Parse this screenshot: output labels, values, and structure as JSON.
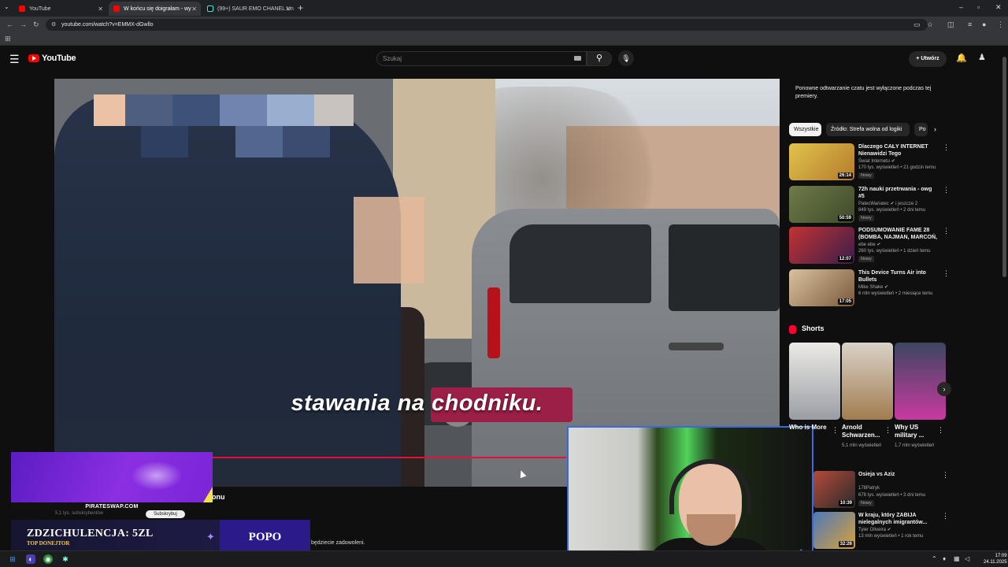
{
  "browser": {
    "tabs": [
      {
        "title": "YouTube",
        "active": false
      },
      {
        "title": "W końcu się doigrałam - wy",
        "active": true
      },
      {
        "title": "(99+) SAUR EMO CHANEL Un",
        "active": false
      }
    ],
    "url": "youtube.com/watch?v=EMMX-dGwllo"
  },
  "yt": {
    "logo_text": "YouTube",
    "search_placeholder": "Szukaj",
    "create_label": "Utwórz"
  },
  "video": {
    "subtitle": "stawania na chodniku.",
    "title_fragment": "onu",
    "desc_fragment": "będziecie zadowoleni.",
    "progress": 0.67
  },
  "overlay": {
    "promo_label": "PIRATESWAP.COM",
    "subs_text": "5,1 tys. subskrybentów",
    "subscribe_label": "Subskrybuj",
    "donation_title": "ZDZICHULENCJA: 5ZL",
    "donation_sub": "TOP DONEJTOR",
    "donation_right": "POPO"
  },
  "sidebar": {
    "chat_note": "Ponowne odtwarzanie czatu jest wyłączone podczas tej premiery.",
    "chips": [
      "Wszystkie",
      "Źródło: Strefa wolna od logiki",
      "Po"
    ],
    "recs": [
      {
        "title": "Dlaczego CAŁY INTERNET Nienawidzi Tego STREAMERA?",
        "channel": "Świat Internetu ✔",
        "meta": "170 tys. wyświetleń • 21 godzin temu",
        "badge": "Nowy",
        "duration": "26:14",
        "color": "#d8a02a"
      },
      {
        "title": "72h nauki przetrwania - owg #5",
        "channel": "PatecWariatec ✔ i jeszcze 2",
        "meta": "849 tys. wyświetleń • 2 dni temu",
        "badge": "Nowy",
        "duration": "50:59",
        "color": "#5b6b3a"
      },
      {
        "title": "PODSUMOWANIE FAME 28 (BOMBA, NAJMAN, MARCOŃ, ...",
        "channel": "ebe ebe ✔",
        "meta": "260 tys. wyświetleń • 1 dzień temu",
        "badge": "Nowy",
        "duration": "12:07",
        "color": "#9b2a2a"
      },
      {
        "title": "This Device Turns Air into Bullets",
        "channel": "Mike Shake ✔",
        "meta": "6 mln wyświetleń • 2 miesiące temu",
        "badge": "",
        "duration": "17:05",
        "color": "#c9a068"
      }
    ],
    "shorts_title": "Shorts",
    "shorts": [
      {
        "title": "Who is More",
        "views": "",
        "color": "#a3a7ad"
      },
      {
        "title": "Arnold Schwarzen...",
        "views": "5,1 mln wyświetleń",
        "color": "#b08a58"
      },
      {
        "title": "Why US military ...",
        "views": "1,7 mln wyświetleń",
        "color": "#2f3a5a"
      }
    ],
    "recs2": [
      {
        "title": "Osieja vs Aziz",
        "channel": "178Patryk",
        "meta": "678 tys. wyświetleń • 3 dni temu",
        "badge": "Nowy",
        "duration": "10:39",
        "color": "#8a3a2a"
      },
      {
        "title": "W kraju, który ZABIJA nielegalnych imigrantów...",
        "channel": "Tyler Oliveira ✔",
        "meta": "13 mln wyświetleń • 1 rok temu",
        "badge": "",
        "duration": "32:26",
        "color": "#3a5a8a"
      }
    ]
  },
  "taskbar": {
    "time": "17:09",
    "date": "24.11.2025"
  }
}
